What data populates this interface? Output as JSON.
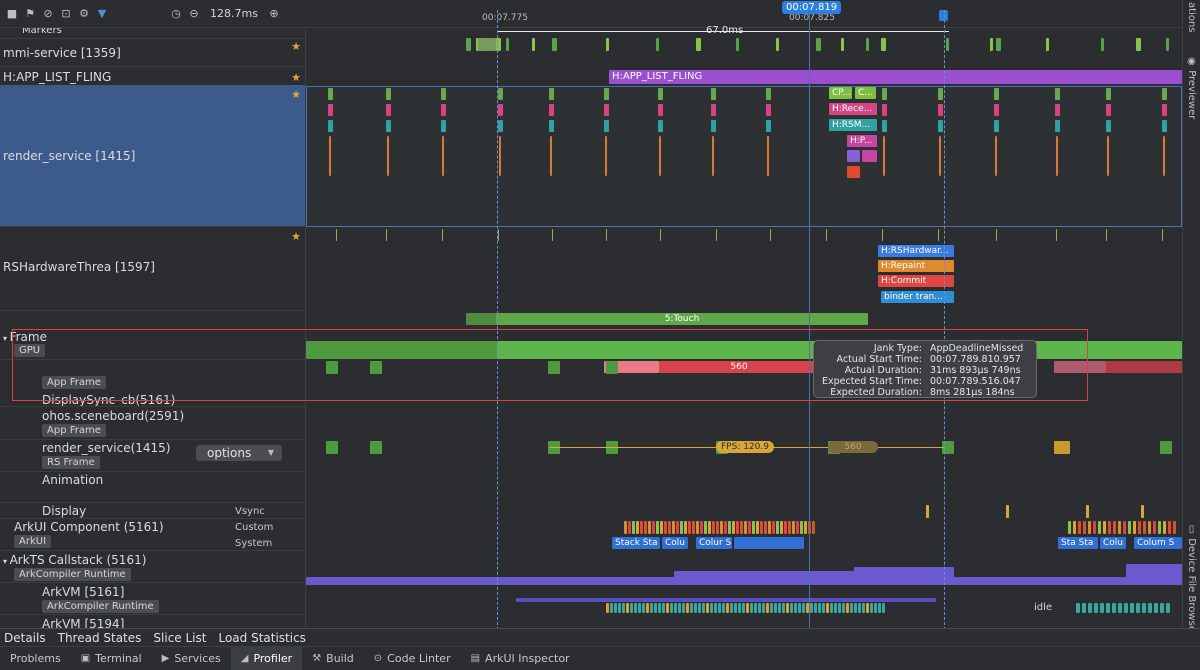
{
  "toolbar": {
    "zoom": "128.7ms",
    "icons": [
      "stop-icon",
      "flag-icon",
      "clear-icon",
      "screenshot-icon",
      "settings-icon",
      "filter-icon",
      "clock-icon",
      "zoom-out-icon",
      "zoom-in-icon"
    ]
  },
  "ruler": {
    "t1": "00:07.775",
    "t2": "00:07.825",
    "cursor": "00:07.819",
    "range": "67.0ms"
  },
  "tracks": {
    "markers": "Markers",
    "mmi": "mmi-service [1359]",
    "fling": "H:APP_LIST_FLING",
    "render": "render_service [1415]",
    "rshw": "RSHardwareThrea [1597]",
    "frame": "Frame",
    "gpu": "GPU",
    "app_frame": "App Frame",
    "displaysync": "DisplaySync_cb(5161)",
    "sceneboard": "ohos.sceneboard(2591)",
    "app_frame2": "App Frame",
    "render_proc": "render_service(1415)",
    "rs_frame": "RS Frame",
    "options": "options",
    "animation": "Animation",
    "display": "Display",
    "vsync": "Vsync",
    "arkui_component": "ArkUI Component (5161)",
    "custom": "Custom",
    "arkui": "ArkUI",
    "system": "System",
    "arkts": "ArkTS Callstack (5161)",
    "ark_runtime": "ArkCompiler Runtime",
    "arkvm1": "ArkVM [5161]",
    "ark_runtime2": "ArkCompiler Runtime",
    "arkvm2": "ArkVM [5194]"
  },
  "slices": {
    "fling": "H:APP_LIST_FLING",
    "cp": "CP...",
    "c": "C...",
    "rece": "H:Rece...",
    "rsm": "H:RSM...",
    "hp": "H:P...",
    "rshw": "H:RSHardwar...",
    "repaint": "H:Repaint",
    "commit": "H:Commit",
    "binder": "binder tran...",
    "touch": "5:Touch",
    "jank": "560",
    "fps": "FPS: 120.9",
    "fps_ghost": "560",
    "stack1": "Stack Sta",
    "col1": "Colu",
    "col2": "Colur S",
    "sta2": "Sta Sta",
    "col3": "Colu",
    "col4": "Colum S",
    "idle": "idle"
  },
  "tooltip": {
    "jank_type_k": "Jank Type:",
    "jank_type_v": "AppDeadlineMissed",
    "actual_start_k": "Actual Start Time:",
    "actual_start_v": "00:07.789.810.957",
    "actual_dur_k": "Actual Duration:",
    "actual_dur_v": "31ms 893μs 749ns",
    "exp_start_k": "Expected Start Time:",
    "exp_start_v": "00:07.789.516.047",
    "exp_dur_k": "Expected Duration:",
    "exp_dur_v": "8ms 281μs 184ns"
  },
  "right_strip": {
    "top": "ations",
    "previewer": "Previewer",
    "device": "Device File Browser"
  },
  "details_tabs": [
    "Details",
    "Thread States",
    "Slice List",
    "Load Statistics"
  ],
  "bottom_tabs": [
    {
      "label": "Problems",
      "icon": "problems-icon"
    },
    {
      "label": "Terminal",
      "icon": "terminal-icon"
    },
    {
      "label": "Services",
      "icon": "services-icon"
    },
    {
      "label": "Profiler",
      "icon": "profiler-icon"
    },
    {
      "label": "Build",
      "icon": "build-icon"
    },
    {
      "label": "Code Linter",
      "icon": "code-linter-icon"
    },
    {
      "label": "ArkUI Inspector",
      "icon": "arkui-inspector-icon"
    }
  ],
  "colors": {
    "accent": "#2c7ee0",
    "fling": "#9a4fd0",
    "green": "#5aa34a",
    "jank_red": "#d9434e",
    "jank_pink": "#e87a8a",
    "fps_gold": "#d9a834",
    "selection": "#3c5a8c"
  }
}
